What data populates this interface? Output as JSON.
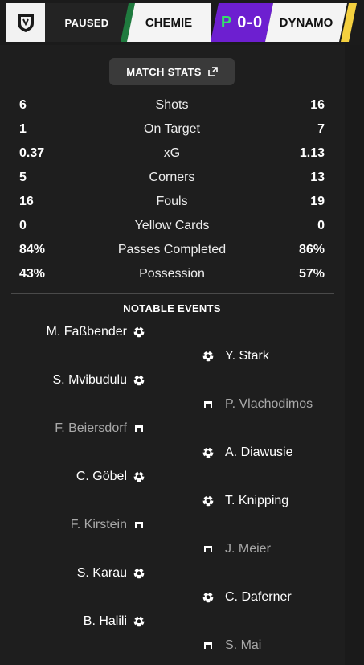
{
  "header": {
    "status": "PAUSED",
    "home_team": "CHEMIE",
    "away_team": "DYNAMO",
    "period": "P",
    "score_home": "0",
    "score_sep": "-",
    "score_away": "0",
    "colors": {
      "home": "#1f7a3e",
      "away": "#f4d03f",
      "score_bg": "#6d1fd0",
      "period": "#35e06a"
    }
  },
  "stats": {
    "button_label": "MATCH STATS",
    "rows": [
      {
        "home": "6",
        "label": "Shots",
        "away": "16"
      },
      {
        "home": "1",
        "label": "On Target",
        "away": "7"
      },
      {
        "home": "0.37",
        "label": "xG",
        "away": "1.13"
      },
      {
        "home": "5",
        "label": "Corners",
        "away": "13"
      },
      {
        "home": "16",
        "label": "Fouls",
        "away": "19"
      },
      {
        "home": "0",
        "label": "Yellow Cards",
        "away": "0"
      },
      {
        "home": "84%",
        "label": "Passes Completed",
        "away": "86%"
      },
      {
        "home": "43%",
        "label": "Possession",
        "away": "57%"
      }
    ]
  },
  "events": {
    "title": "NOTABLE EVENTS",
    "items": [
      {
        "side": "home",
        "name": "M. Faßbender",
        "icon": "ball-icon",
        "faded": false
      },
      {
        "side": "away",
        "name": "Y. Stark",
        "icon": "ball-icon",
        "faded": false
      },
      {
        "side": "home",
        "name": "S. Mvibudulu",
        "icon": "ball-icon",
        "faded": false
      },
      {
        "side": "away",
        "name": "P. Vlachodimos",
        "icon": "save-icon",
        "faded": true
      },
      {
        "side": "home",
        "name": "F. Beiersdorf",
        "icon": "save-icon",
        "faded": true
      },
      {
        "side": "away",
        "name": "A. Diawusie",
        "icon": "ball-icon",
        "faded": false
      },
      {
        "side": "home",
        "name": "C. Göbel",
        "icon": "ball-icon",
        "faded": false
      },
      {
        "side": "away",
        "name": "T. Knipping",
        "icon": "ball-icon",
        "faded": false
      },
      {
        "side": "home",
        "name": "F. Kirstein",
        "icon": "save-icon",
        "faded": true
      },
      {
        "side": "away",
        "name": "J. Meier",
        "icon": "save-icon",
        "faded": true
      },
      {
        "side": "home",
        "name": "S. Karau",
        "icon": "ball-icon",
        "faded": false
      },
      {
        "side": "away",
        "name": "C. Daferner",
        "icon": "ball-icon",
        "faded": false
      },
      {
        "side": "home",
        "name": "B. Halili",
        "icon": "ball-icon",
        "faded": false
      },
      {
        "side": "away",
        "name": "S. Mai",
        "icon": "save-icon",
        "faded": true
      }
    ]
  }
}
